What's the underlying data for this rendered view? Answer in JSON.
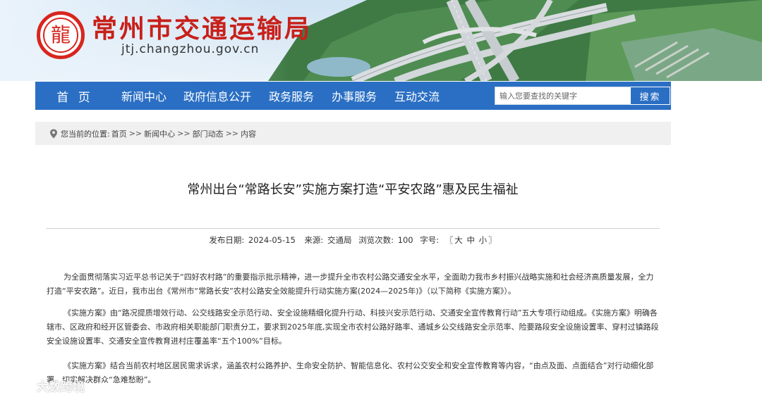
{
  "site": {
    "title": "常州市交通运输局",
    "domain": "jtj.changzhou.gov.cn",
    "logo_glyph": "龍",
    "brand_color": "#c8201a"
  },
  "nav": {
    "items": [
      "首 页",
      "新闻中心",
      "政府信息公开",
      "政务服务",
      "办事服务",
      "互动交流"
    ],
    "bar_color": "#2a6fc4",
    "search_placeholder": "输入您要查找的关键字",
    "search_button": "搜索"
  },
  "breadcrumb": {
    "icon": "location-pin-icon",
    "prefix": "您当前的位置:",
    "items": [
      "首页",
      "新闻中心",
      "部门动态",
      "内容"
    ],
    "separator": ">>"
  },
  "article": {
    "title": "常州出台“常路长安”实施方案打造“平安农路”惠及民生福祉",
    "meta": {
      "date_label": "发布日期:",
      "date": "2024-05-15",
      "source_label": "来源:",
      "source": "交通局",
      "views_label": "浏览次数:",
      "views": "100",
      "fontsize_label": "字号:",
      "fontsize_open": "〖",
      "fontsize_large": "大",
      "fontsize_medium": "中",
      "fontsize_small": "小",
      "fontsize_close": "〗"
    },
    "paragraphs": [
      "为全面贯彻落实习近平总书记关于“四好农村路”的重要指示批示精神，进一步提升全市农村公路交通安全水平，全面助力我市乡村振兴战略实施和社会经济高质量发展，全力打造“平安农路”。近日，我市出台《常州市“常路长安”农村公路安全效能提升行动实施方案(2024—2025年)》（以下简称《实施方案》）。",
      "《实施方案》由“路况提质增效行动、公交线路安全示范行动、安全设施精细化提升行动、科技兴安示范行动、交通安全宣传教育行动”五大专项行动组成。《实施方案》明确各辖市、区政府和经开区管委会、市政府相关职能部门职责分工，要求到2025年底,实现全市农村公路好路率、通城乡公交线路安全示范率、险要路段安全设施设置率、穿村过镇路段安全设施设置率、交通安全宣传教育进村庄覆盖率“五个100%”目标。",
      "《实施方案》结合当前农村地区居民需求诉求，涵盖农村公路养护、生命安全防护、智能信息化、农村公交安全和安全宣传教育等内容，“由点及面、点面结合”对行动细化部署，切实解决群众“急难愁盼”。"
    ]
  },
  "watermark": {
    "text": "大数跨境"
  }
}
